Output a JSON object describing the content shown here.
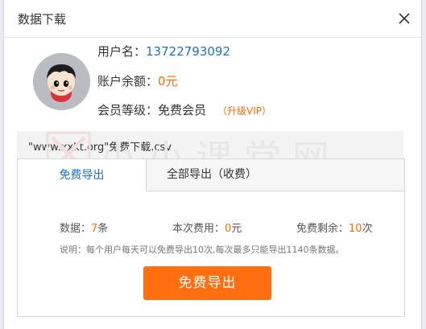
{
  "dialog": {
    "title": "数据下载"
  },
  "user": {
    "username_label": "用户名：",
    "username": "13722793092",
    "balance_label": "账户余额：",
    "balance": "0元",
    "level_label": "会员等级：",
    "level": "免费会员",
    "upgrade_link": "（升级VIP）"
  },
  "file": {
    "name": "\"www.xxkt.org\"免费下载.csv"
  },
  "tabs": [
    {
      "label": "免费导出",
      "active": true
    },
    {
      "label": "全部导出（收费）",
      "active": false
    }
  ],
  "stats": {
    "count_label": "数据：",
    "count_value": "7",
    "count_unit": "条",
    "cost_label": "本次费用：",
    "cost_value": "0",
    "cost_unit": "元",
    "remaining_label": "免费剩余：",
    "remaining_value": "10",
    "remaining_unit": "次"
  },
  "note": "说明：每个用户每天可以免费导出10次,每次最多只能导出1140条数据。",
  "action": {
    "button_label": "免费导出"
  },
  "watermark": {
    "text": "小小课堂网",
    "url": "www.xxkt.org"
  },
  "colors": {
    "accent_orange": "#ff6f10",
    "link_blue": "#1a73c4"
  }
}
